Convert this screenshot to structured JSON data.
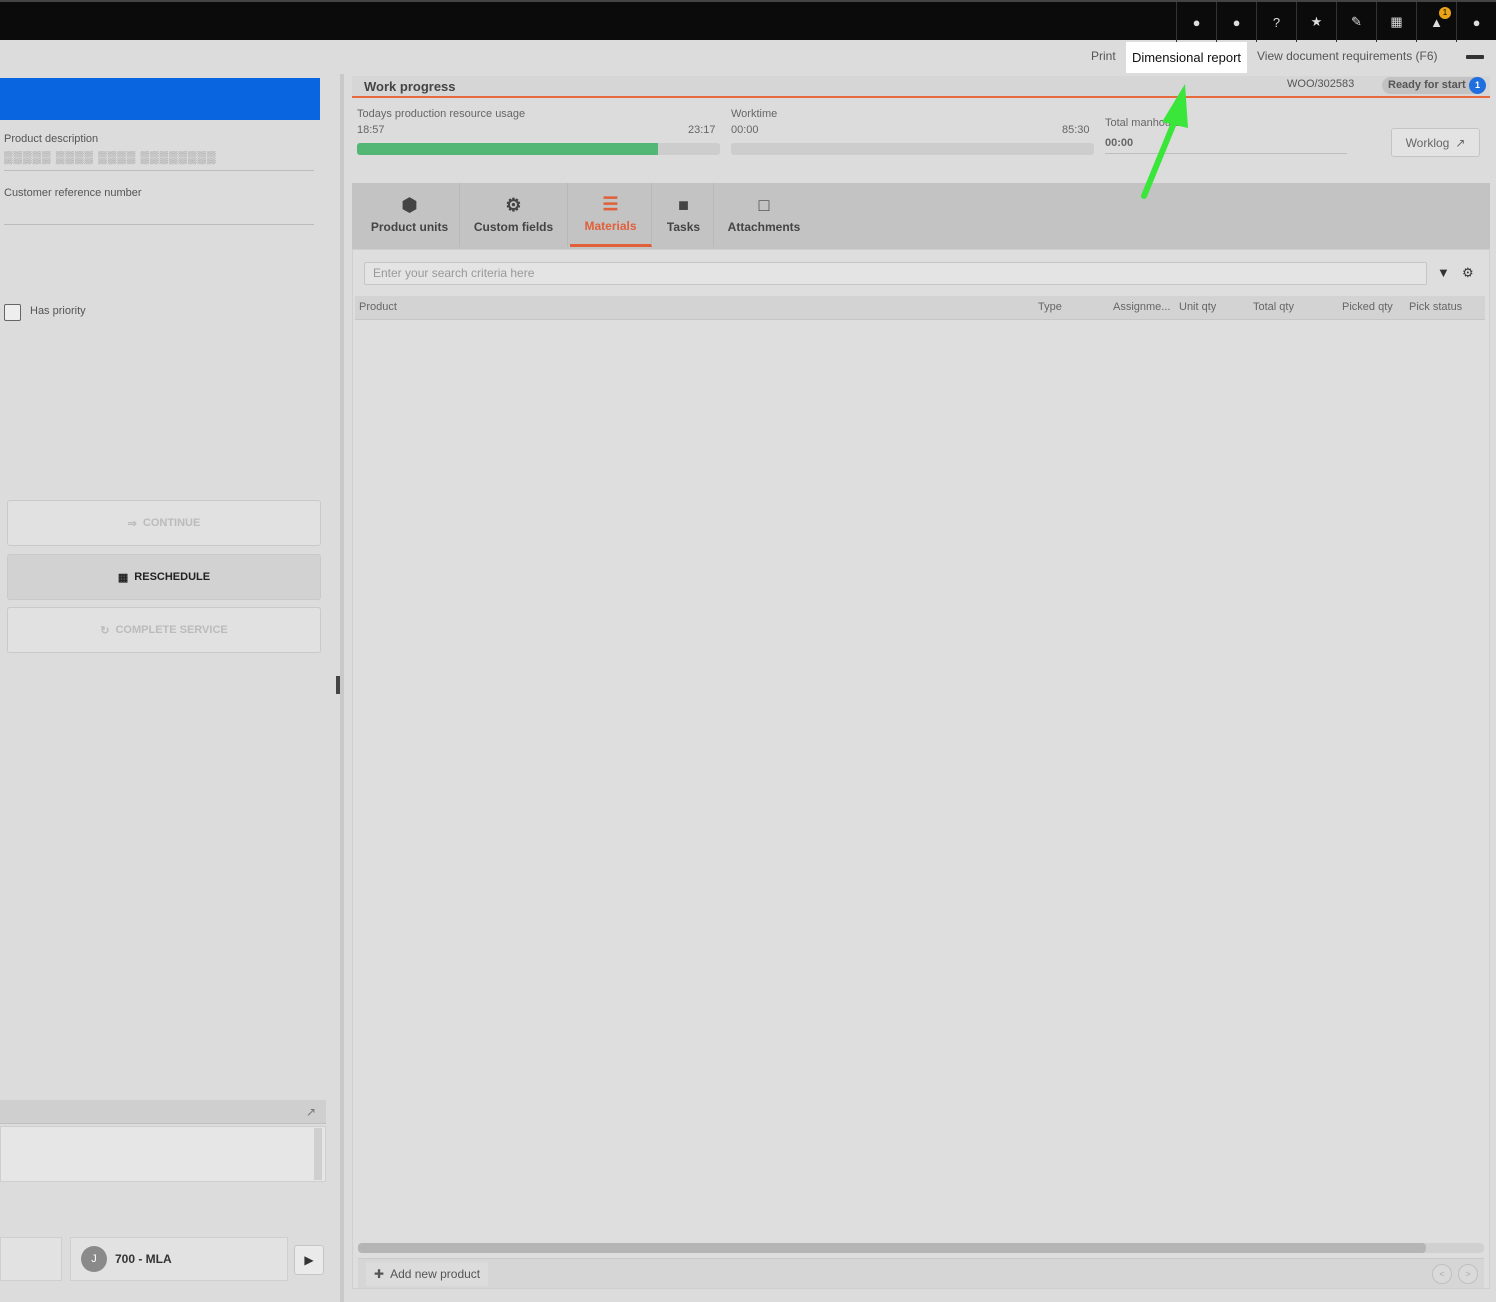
{
  "topbar": {
    "icons": [
      {
        "name": "clock-icon",
        "glyph": "●"
      },
      {
        "name": "chat-icon",
        "glyph": "●",
        "badge": ""
      },
      {
        "name": "help-icon",
        "glyph": "?"
      },
      {
        "name": "star-icon",
        "glyph": "★"
      },
      {
        "name": "pencil-icon",
        "glyph": "✎"
      },
      {
        "name": "grid-icon",
        "glyph": "▦"
      },
      {
        "name": "bell-icon",
        "glyph": "▲",
        "badge": "1"
      },
      {
        "name": "user-icon",
        "glyph": "●"
      }
    ]
  },
  "actions": {
    "print": "Print",
    "dimensional_report": "Dimensional report",
    "view_doc_requirements": "View document requirements (F6)"
  },
  "left": {
    "product_description_label": "Product description",
    "product_description_value": "▒▒▒▒▒ ▒▒▒▒ ▒▒▒▒ ▒▒▒▒▒▒▒▒",
    "customer_ref_label": "Customer reference number",
    "has_priority_label": "Has priority",
    "buttons": {
      "continue": "CONTINUE",
      "reschedule": "RESCHEDULE",
      "complete_service": "COMPLETE SERVICE"
    },
    "user": {
      "avatar_text": "J",
      "label": "700 - MLA"
    }
  },
  "work_progress": {
    "title": "Work progress",
    "order_id": "WOO/302583",
    "status": "Ready for start",
    "status_count": "1",
    "resource_usage_label": "Todays production resource usage",
    "resource_usage_start": "18:57",
    "resource_usage_end": "23:17",
    "resource_usage_fill": 0.83,
    "worktime_label": "Worktime",
    "worktime_start": "00:00",
    "worktime_end": "85:30",
    "total_label": "Total manhours",
    "total_value": "00:00",
    "worklog_label": "Worklog"
  },
  "tabs": [
    {
      "label": "Product units",
      "icon": "product-units-icon",
      "glyph": "⬢"
    },
    {
      "label": "Custom fields",
      "icon": "custom-fields-icon",
      "glyph": "⚙"
    },
    {
      "label": "Materials",
      "icon": "materials-icon",
      "glyph": "☰",
      "active": true
    },
    {
      "label": "Tasks",
      "icon": "tasks-icon",
      "glyph": "■"
    },
    {
      "label": "Attachments",
      "icon": "attachments-icon",
      "glyph": "□"
    }
  ],
  "materials": {
    "search_placeholder": "Enter your search criteria here",
    "columns": [
      "Product",
      "Type",
      "Assignme...",
      "Unit qty",
      "Total qty",
      "Picked qty",
      "Pick status"
    ],
    "add_new_product": "Add new product"
  },
  "colors": {
    "accent_orange": "#e0603a",
    "blue_header": "#0a66e0",
    "progress_green": "#52b774",
    "annotation_arrow": "#39e639"
  }
}
